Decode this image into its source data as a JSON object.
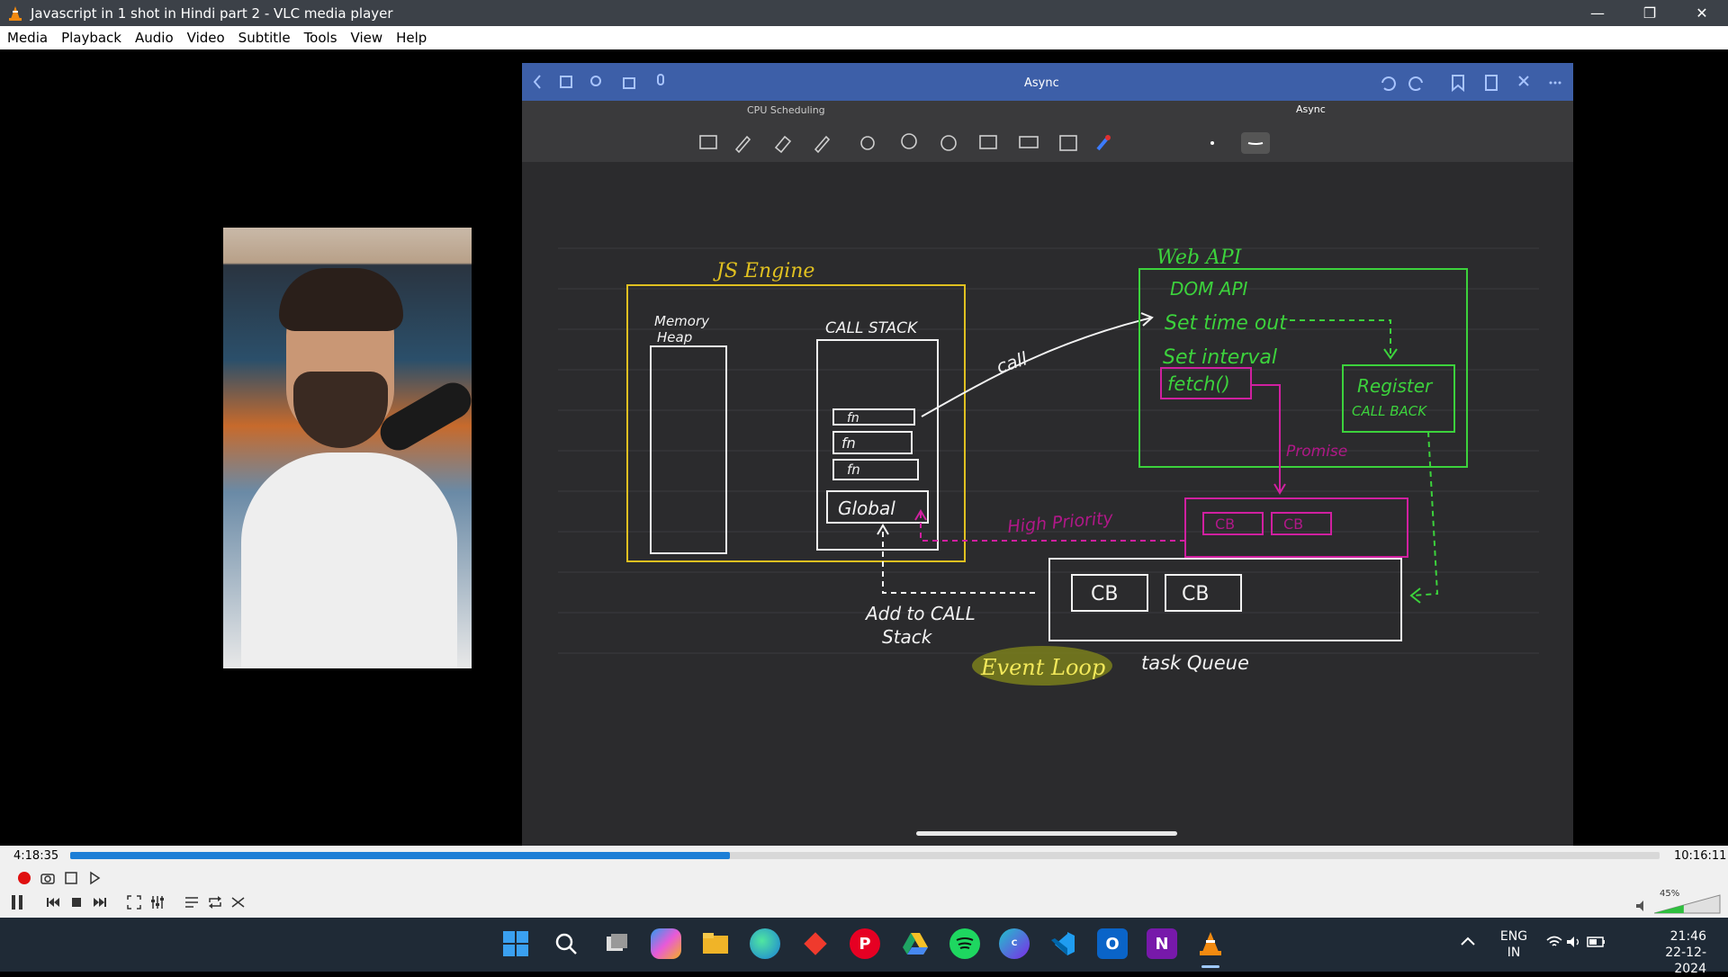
{
  "window": {
    "title": "Javascript in 1 shot in Hindi part 2 - VLC media player",
    "minimize": "—",
    "restore": "❐",
    "close": "✕"
  },
  "menu": [
    "Media",
    "Playback",
    "Audio",
    "Video",
    "Subtitle",
    "Tools",
    "View",
    "Help"
  ],
  "ipad": {
    "doc_title": "Async",
    "tab_left": "CPU Scheduling",
    "tab_right": "Async",
    "accent": "#3d5fa8"
  },
  "notes": {
    "js_engine": "JS Engine",
    "memory_heap_1": "Memory",
    "memory_heap_2": "Heap",
    "call_stack": "CALL STACK",
    "fn1": "fn",
    "fn2": "fn",
    "fn3": "fn",
    "global": "Global",
    "call": "call",
    "web_api": "Web API",
    "dom_api": "DOM API",
    "set_timeout": "Set time out",
    "set_interval": "Set interval",
    "fetch": "fetch()",
    "register_1": "Register",
    "register_2": "CALL BACK",
    "promise": "Promise",
    "high_priority": "High Priority",
    "cb_pink_1": "CB",
    "cb_pink_2": "CB",
    "cb_1": "CB",
    "cb_2": "CB",
    "add_to_call_1": "Add to CALL",
    "add_to_call_2": "Stack",
    "task_queue": "task Queue",
    "event_loop": "Event Loop",
    "colors": {
      "yellow": "#e0c020",
      "green": "#3cd23c",
      "pink": "#d020a0",
      "white": "#f2f2f2"
    }
  },
  "player": {
    "elapsed": "4:18:35",
    "total": "10:16:11",
    "progress": 0.415,
    "volume": "45%",
    "volume_level": 0.45
  },
  "taskbar": {
    "lang_1": "ENG",
    "lang_2": "IN",
    "time": "21:46",
    "date": "22-12-2024",
    "apps": [
      "windows-start-icon",
      "search-icon",
      "task-view-icon",
      "copilot-icon",
      "file-explorer-icon",
      "edge-icon",
      "anydesk-icon",
      "pinterest-icon",
      "google-drive-icon",
      "spotify-icon",
      "canva-icon",
      "vscode-icon",
      "outlook-icon",
      "onenote-icon",
      "vlc-icon"
    ]
  }
}
